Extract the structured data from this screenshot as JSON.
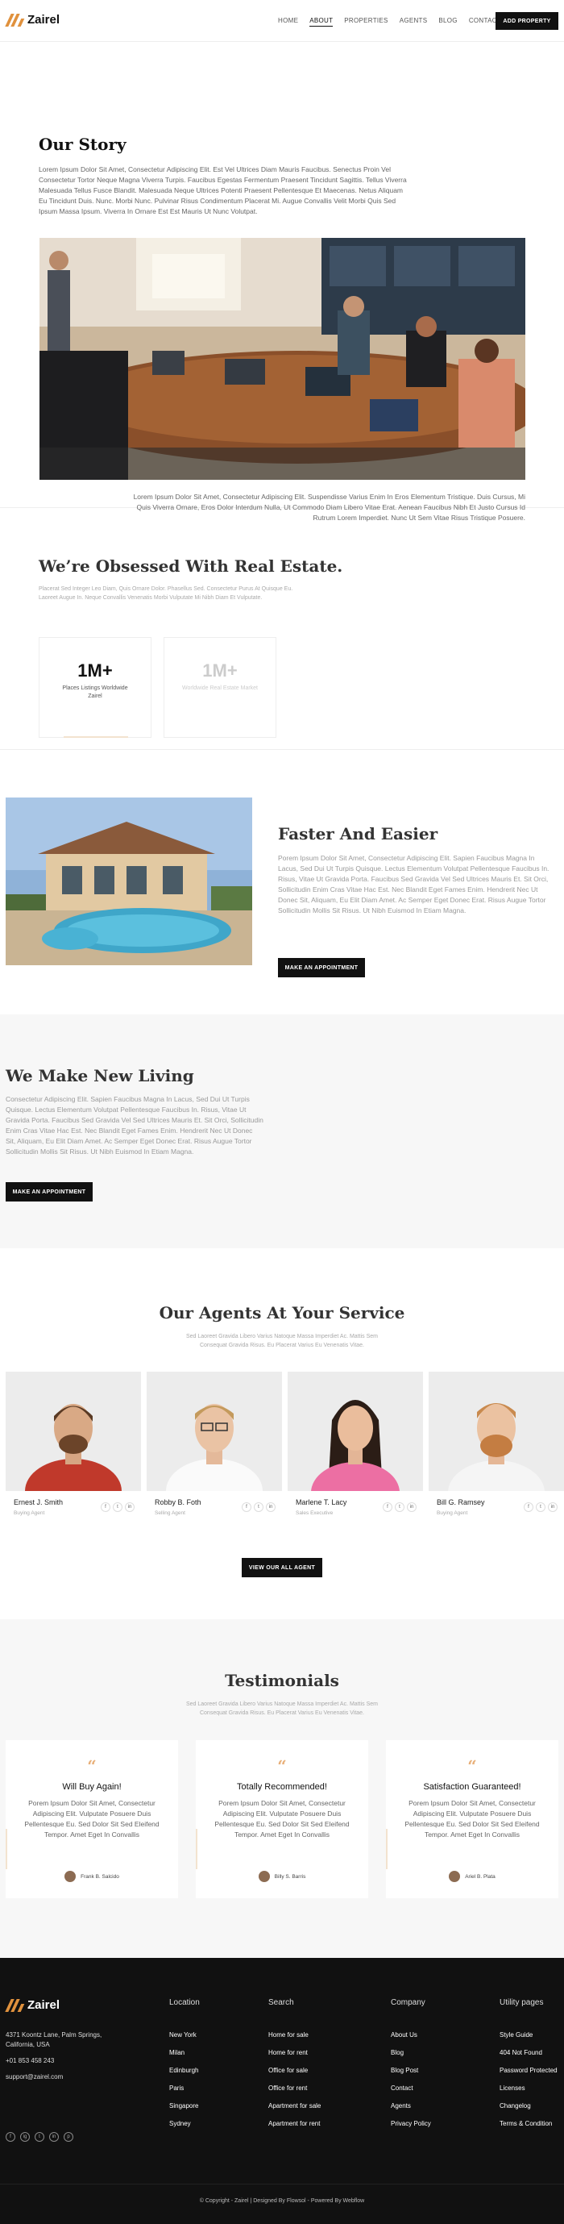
{
  "nav": {
    "logo": "Zairel",
    "links": [
      "HOME",
      "ABOUT",
      "PROPERTIES",
      "AGENTS",
      "BLOG",
      "CONTACT"
    ],
    "cta": "ADD PROPERTY"
  },
  "story": {
    "title": "Our Story",
    "p1": "Lorem Ipsum Dolor Sit Amet, Consectetur Adipiscing Elit. Est Vel Ultrices Diam Mauris Faucibus. Senectus Proin Vel Consectetur Tortor Neque Magna Viverra Turpis. Faucibus Egestas Fermentum Praesent Tincidunt Sagittis. Tellus Viverra Malesuada Tellus Fusce Blandit. Malesuada Neque Ultrices Potenti Praesent Pellentesque Et Maecenas. Netus Aliquam Eu Tincidunt Duis. Nunc. Morbi Nunc. Pulvinar Risus Condimentum Placerat Mi. Augue Convallis Velit Morbi Quis Sed Ipsum Massa Ipsum. Viverra In Ornare Est Est Mauris Ut Nunc Volutpat.",
    "p2": "Lorem Ipsum Dolor Sit Amet, Consectetur Adipiscing Elit. Suspendisse Varius Enim In Eros Elementum Tristique. Duis Cursus, Mi Quis Viverra Ornare, Eros Dolor Interdum Nulla, Ut Commodo Diam Libero Vitae Erat. Aenean Faucibus Nibh Et Justo Cursus Id Rutrum Lorem Imperdiet. Nunc Ut Sem Vitae Risus Tristique Posuere."
  },
  "obsessed": {
    "title": "We’re Obsessed With Real Estate.",
    "p": "Placerat Sed Integer Leo Diam, Quis Ornare Dolor. Phasellus Sed. Consectetur Purus At Quisque Eu. Laoreet Augue In. Neque Convallis Venenatis Morbi Vulputate Mi Nibh Diam Et Vulputate.",
    "stats": [
      {
        "value": "1M+",
        "label": "Places Listings Worldwide Zairel"
      },
      {
        "value": "1M+",
        "label": "Worldwide Real Estate Market"
      }
    ]
  },
  "faster": {
    "title": "Faster And Easier",
    "p": "Porem Ipsum Dolor Sit Amet, Consectetur Adipiscing Elit. Sapien Faucibus Magna In Lacus, Sed Dui Ut Turpis Quisque. Lectus Elementum Volutpat Pellentesque Faucibus In. Risus, Vitae Ut Gravida Porta. Faucibus Sed Gravida Vel Sed Ultrices Mauris Et. Sit Orci, Sollicitudin Enim Cras Vitae Hac Est. Nec Blandit Eget Fames Enim. Hendrerit Nec Ut Donec Sit, Aliquam, Eu Elit Diam Amet. Ac Semper Eget Donec Erat. Risus Augue Tortor Sollicitudin Mollis Sit Risus. Ut Nibh Euismod In Etiam Magna.",
    "cta": "MAKE AN APPOINTMENT"
  },
  "living": {
    "title": "We Make New Living",
    "p": "Consectetur Adipiscing Elit. Sapien Faucibus Magna In Lacus, Sed Dui Ut Turpis Quisque. Lectus Elementum Volutpat Pellentesque Faucibus In. Risus, Vitae Ut Gravida Porta. Faucibus Sed Gravida Vel Sed Ultrices Mauris Et. Sit Orci, Sollicitudin Enim Cras Vitae Hac Est. Nec Blandit Eget Fames Enim. Hendrerit Nec Ut Donec Sit, Aliquam, Eu Elit Diam Amet. Ac Semper Eget Donec Erat. Risus Augue Tortor Sollicitudin Mollis Sit Risus. Ut Nibh Euismod In Etiam Magna.",
    "cta": "MAKE AN APPOINTMENT"
  },
  "agents": {
    "title": "Our Agents At Your Service",
    "p": "Sed Laoreet Gravida Libero Varius Natoque Massa Imperdiet Ac. Mattis Sem Consequat Gravida Risus. Eu Placerat Varius Eu Venenatis Vitae.",
    "list": [
      {
        "name": "Ernest J. Smith",
        "role": "Buying Agent"
      },
      {
        "name": "Robby B. Foth",
        "role": "Selling Agent"
      },
      {
        "name": "Marlene T. Lacy",
        "role": "Sales Executive"
      },
      {
        "name": "Bill G. Ramsey",
        "role": "Buying Agent"
      }
    ],
    "social_icons": [
      "f",
      "t",
      "in"
    ],
    "cta": "VIEW OUR ALL AGENT"
  },
  "testimonials": {
    "title": "Testimonials",
    "p": "Sed Laoreet Gravida Libero Varius Natoque Massa Imperdiet Ac. Mattis Sem Consequat Gravida Risus. Eu Placerat Varius Eu Venenatis Vitae.",
    "quote_mark": "“",
    "items": [
      {
        "title": "Will Buy Again!",
        "body": "Porem Ipsum Dolor Sit Amet, Consectetur Adipiscing Elit. Vulputate Posuere Duis Pellentesque Eu. Sed Dolor Sit Sed Eleifend Tempor. Amet Eget In Convallis",
        "author": "Frank B. Salcido"
      },
      {
        "title": "Totally Recommended!",
        "body": "Porem Ipsum Dolor Sit Amet, Consectetur Adipiscing Elit. Vulputate Posuere Duis Pellentesque Eu. Sed Dolor Sit Sed Eleifend Tempor. Amet Eget In Convallis",
        "author": "Billy S. Barris"
      },
      {
        "title": "Satisfaction Guaranteed!",
        "body": "Porem Ipsum Dolor Sit Amet, Consectetur Adipiscing Elit. Vulputate Posuere Duis Pellentesque Eu. Sed Dolor Sit Sed Eleifend Tempor. Amet Eget In Convallis",
        "author": "Ariel B. Plata"
      }
    ]
  },
  "footer": {
    "logo": "Zairel",
    "address": "4371 Koontz Lane, Palm Springs, California, USA",
    "phone": "+01 853 458 243",
    "email": "support@zairel.com",
    "social_icons": [
      "f",
      "ig",
      "t",
      "in",
      "p"
    ],
    "columns": [
      {
        "title": "Location",
        "links": [
          "New York",
          "Milan",
          "Edinburgh",
          "Paris",
          "Singapore",
          "Sydney"
        ]
      },
      {
        "title": "Search",
        "links": [
          "Home for sale",
          "Home for rent",
          "Office for sale",
          "Office for rent",
          "Apartment for sale",
          "Apartment for rent"
        ]
      },
      {
        "title": "Company",
        "links": [
          "About Us",
          "Blog",
          "Blog Post",
          "Contact",
          "Agents",
          "Privacy Policy"
        ]
      },
      {
        "title": "Utility pages",
        "links": [
          "Style Guide",
          "404 Not Found",
          "Password Protected",
          "Licenses",
          "Changelog",
          "Terms & Condition"
        ]
      }
    ],
    "copyright": "© Copyright - Zairel | Designed By Flowsol - Powered By Webflow"
  }
}
